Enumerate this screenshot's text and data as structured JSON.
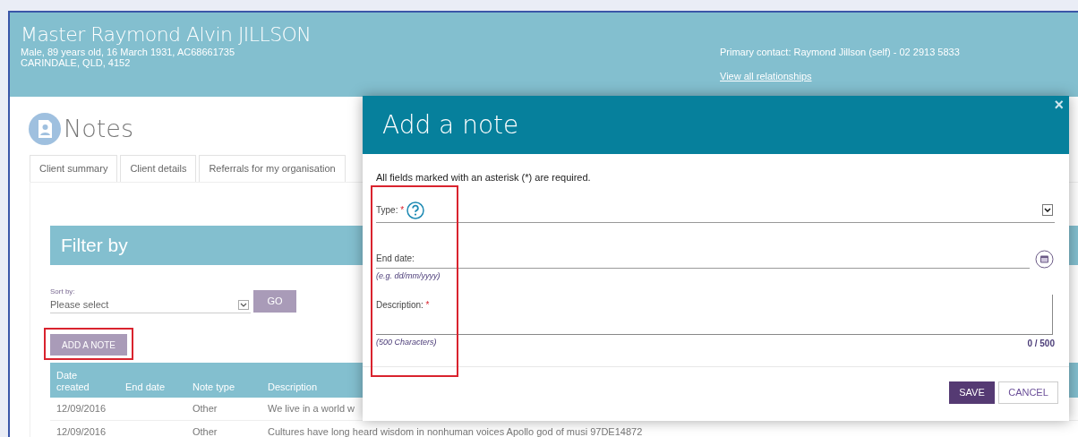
{
  "client": {
    "name": "Master Raymond Alvin JILLSON",
    "details": "Male, 89 years old, 16 March 1931, AC68661735",
    "address": "CARINDALE, QLD, 4152",
    "primary_contact": "Primary contact: Raymond Jillson (self) - 02 2913 5833",
    "relationships_link": "View all relationships"
  },
  "page_title": "Notes",
  "tabs": [
    {
      "label": "Client summary",
      "selected": false
    },
    {
      "label": "Client details",
      "selected": false
    },
    {
      "label": "Referrals for my organisation",
      "selected": false
    }
  ],
  "filter": {
    "title": "Filter by",
    "sort_label": "Sort by:",
    "sort_value": "Please select",
    "go_button": "GO"
  },
  "add_button": "ADD A NOTE",
  "table": {
    "columns": [
      "Date\ncreated",
      "End date",
      "Note type",
      "Description"
    ],
    "rows": [
      [
        "12/09/2016",
        "",
        "Other",
        "We live in a world w"
      ],
      [
        "12/09/2016",
        "",
        "Other",
        "Cultures have long heard wisdom in nonhuman voices Apollo god of musi 97DE14872"
      ]
    ]
  },
  "modal": {
    "title": "Add a note",
    "close": "×",
    "intro": "All fields marked with an asterisk (*) are required.",
    "type_label": "Type:",
    "required": "*",
    "end_date_label": "End date:",
    "end_date_hint": "(e.g. dd/mm/yyyy)",
    "description_label": "Description:",
    "char_hint": "(500 Characters)",
    "char_count": "0 / 500",
    "save": "SAVE",
    "cancel": "CANCEL"
  }
}
